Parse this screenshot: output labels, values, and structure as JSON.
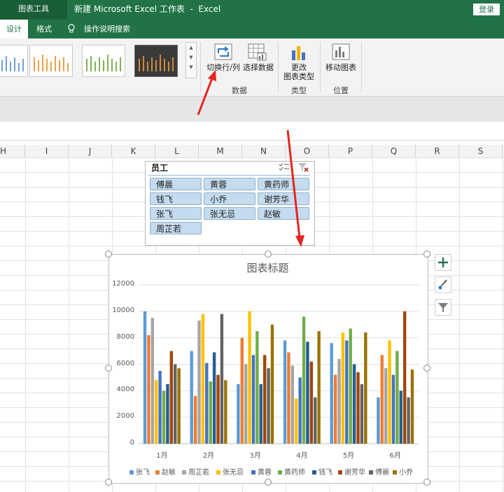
{
  "titlebar": {
    "context_tools": "图表工具",
    "title": "新建 Microsoft Excel 工作表  -  Excel",
    "login": "登录"
  },
  "tabs": {
    "design": "设计",
    "format": "格式",
    "search": "操作说明搜索"
  },
  "ribbon": {
    "switch_row_col": "切换行/列",
    "select_data": "选择数据",
    "change_type_line1": "更改",
    "change_type_line2": "图表类型",
    "move_chart": "移动图表",
    "group_data": "数据",
    "group_type": "类型",
    "group_location": "位置"
  },
  "columns": [
    "H",
    "I",
    "J",
    "K",
    "L",
    "M",
    "N",
    "O",
    "P",
    "Q",
    "R",
    "S"
  ],
  "slicer": {
    "title": "员工",
    "items": [
      "傅晨",
      "黄蓉",
      "黄药师",
      "钱飞",
      "小乔",
      "谢芳华",
      "张飞",
      "张无忌",
      "赵敏",
      "周芷若"
    ]
  },
  "chart_data": {
    "type": "bar",
    "title": "图表标题",
    "categories": [
      "1月",
      "2月",
      "3月",
      "4月",
      "5月",
      "6月"
    ],
    "ylim": [
      0,
      12000
    ],
    "yticks": [
      "0",
      "2000",
      "4000",
      "6000",
      "8000",
      "10000",
      "12000"
    ],
    "grid": true,
    "legend_position": "bottom",
    "series": [
      {
        "name": "张飞",
        "color": "#5b9bd5",
        "values": [
          10000,
          7000,
          4500,
          7800,
          7600,
          3500
        ]
      },
      {
        "name": "赵敏",
        "color": "#ed7d31",
        "values": [
          8200,
          3600,
          8000,
          6900,
          5200,
          6700
        ]
      },
      {
        "name": "周芷若",
        "color": "#a5a5a5",
        "values": [
          9500,
          9300,
          6000,
          5900,
          6400,
          5700
        ]
      },
      {
        "name": "张无忌",
        "color": "#ffc000",
        "values": [
          4800,
          9800,
          10000,
          3400,
          8400,
          7800
        ]
      },
      {
        "name": "黄蓉",
        "color": "#4472c4",
        "values": [
          5500,
          6100,
          6700,
          5000,
          7800,
          5200
        ]
      },
      {
        "name": "黄药师",
        "color": "#70ad47",
        "values": [
          4000,
          4700,
          8500,
          9600,
          8700,
          7000
        ]
      },
      {
        "name": "钱飞",
        "color": "#255e91",
        "values": [
          4500,
          6900,
          4500,
          7700,
          6000,
          4000
        ]
      },
      {
        "name": "谢芳华",
        "color": "#9e480e",
        "values": [
          7000,
          5200,
          6700,
          6200,
          5400,
          10000
        ]
      },
      {
        "name": "傅晨",
        "color": "#636363",
        "values": [
          6000,
          9800,
          5700,
          3500,
          4500,
          3500
        ]
      },
      {
        "name": "小乔",
        "color": "#997300",
        "values": [
          5700,
          4800,
          9000,
          8500,
          8400,
          5600
        ]
      }
    ]
  }
}
